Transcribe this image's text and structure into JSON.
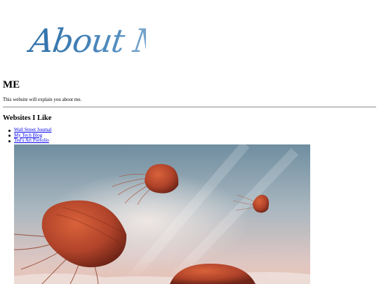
{
  "logo": {
    "text": "About Me",
    "icon": "about-me-script-logo"
  },
  "page": {
    "heading": "ME",
    "intro": "This website will explain you about me."
  },
  "websites": {
    "heading": "Websites I Like",
    "links": [
      {
        "label": "Wall Street Journal"
      },
      {
        "label": "My Tech Blog"
      },
      {
        "label": "Ted's Art Porfolio"
      }
    ]
  },
  "photo": {
    "subject": "jellyfish-floating-in-sky-image"
  },
  "colors": {
    "link": "#0000ee",
    "logo_blue": "#3f7fb6",
    "jellyfish": "#b0432a",
    "sky_top": "#6f8ea0",
    "sky_bottom": "#e2c3bd"
  }
}
